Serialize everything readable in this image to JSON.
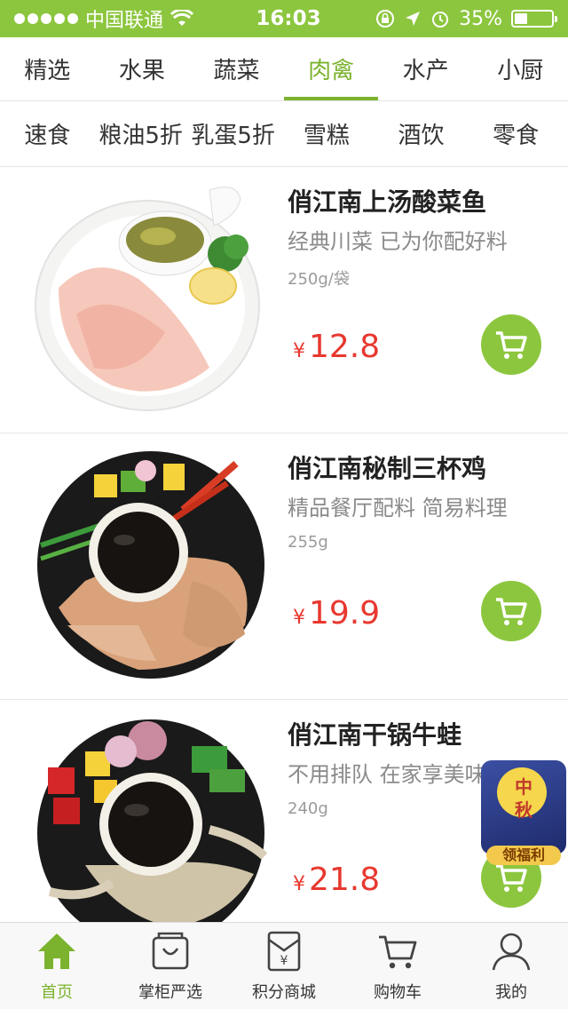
{
  "status_bar": {
    "carrier": "中国联通",
    "time": "16:03",
    "battery": "35%",
    "battery_level": 0.35
  },
  "tabs_primary": [
    {
      "label": "精选"
    },
    {
      "label": "水果"
    },
    {
      "label": "蔬菜"
    },
    {
      "label": "肉禽",
      "active": true
    },
    {
      "label": "水产"
    },
    {
      "label": "小厨"
    }
  ],
  "tabs_secondary": [
    {
      "label": "速食"
    },
    {
      "label": "粮油5折"
    },
    {
      "label": "乳蛋5折"
    },
    {
      "label": "雪糕"
    },
    {
      "label": "酒饮"
    },
    {
      "label": "零食"
    }
  ],
  "products": [
    {
      "name": "俏江南上汤酸菜鱼",
      "desc": "经典川菜 已为你配好料",
      "weight": "250g/袋",
      "currency": "¥",
      "price": "12.8"
    },
    {
      "name": "俏江南秘制三杯鸡",
      "desc": "精品餐厅配料 简易料理",
      "weight": "255g",
      "currency": "¥",
      "price": "19.9"
    },
    {
      "name": "俏江南干锅牛蛙",
      "desc": "不用排队 在家享美味",
      "weight": "240g",
      "currency": "¥",
      "price": "21.8"
    }
  ],
  "float_badge": {
    "line1": "中",
    "line2": "秋",
    "label": "领福利"
  },
  "bottom_nav": [
    {
      "label": "首页",
      "icon": "home-icon",
      "active": true
    },
    {
      "label": "掌柜严选",
      "icon": "bag-icon"
    },
    {
      "label": "积分商城",
      "icon": "points-mall-icon"
    },
    {
      "label": "购物车",
      "icon": "cart-icon"
    },
    {
      "label": "我的",
      "icon": "user-icon"
    }
  ],
  "colors": {
    "brand_green": "#8cc63e",
    "price_red": "#e8382f"
  }
}
